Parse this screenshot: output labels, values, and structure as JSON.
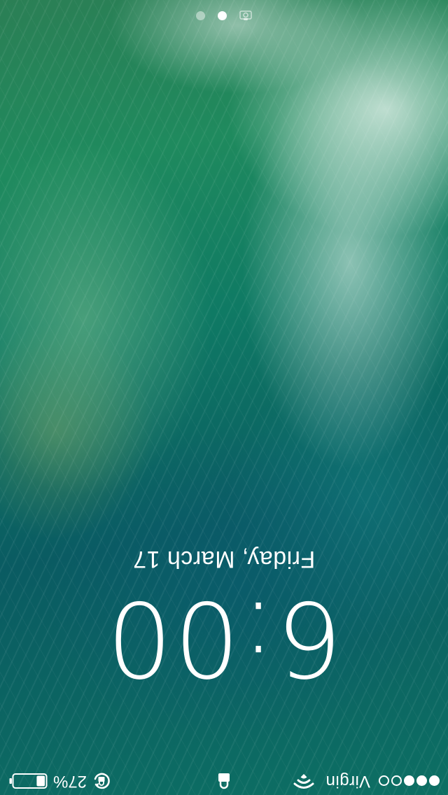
{
  "status_bar": {
    "signal_bars_filled": 3,
    "signal_bars_total": 5,
    "carrier": "Virgin",
    "wifi_icon": "wifi-icon",
    "lock_icon": "lock-icon",
    "rotation_lock_icon": "rotation-lock-icon",
    "battery_percent_text": "27%",
    "battery_level": 0.27
  },
  "lock_screen": {
    "time": "6:00",
    "date": "Friday, March 17"
  },
  "page_indicator": {
    "pages": 2,
    "current_page": 2,
    "camera_icon": "camera-icon"
  },
  "colors": {
    "text": "#ffffff",
    "wallpaper_deep": "#0a5b62",
    "wallpaper_mid": "#0f7a64"
  }
}
